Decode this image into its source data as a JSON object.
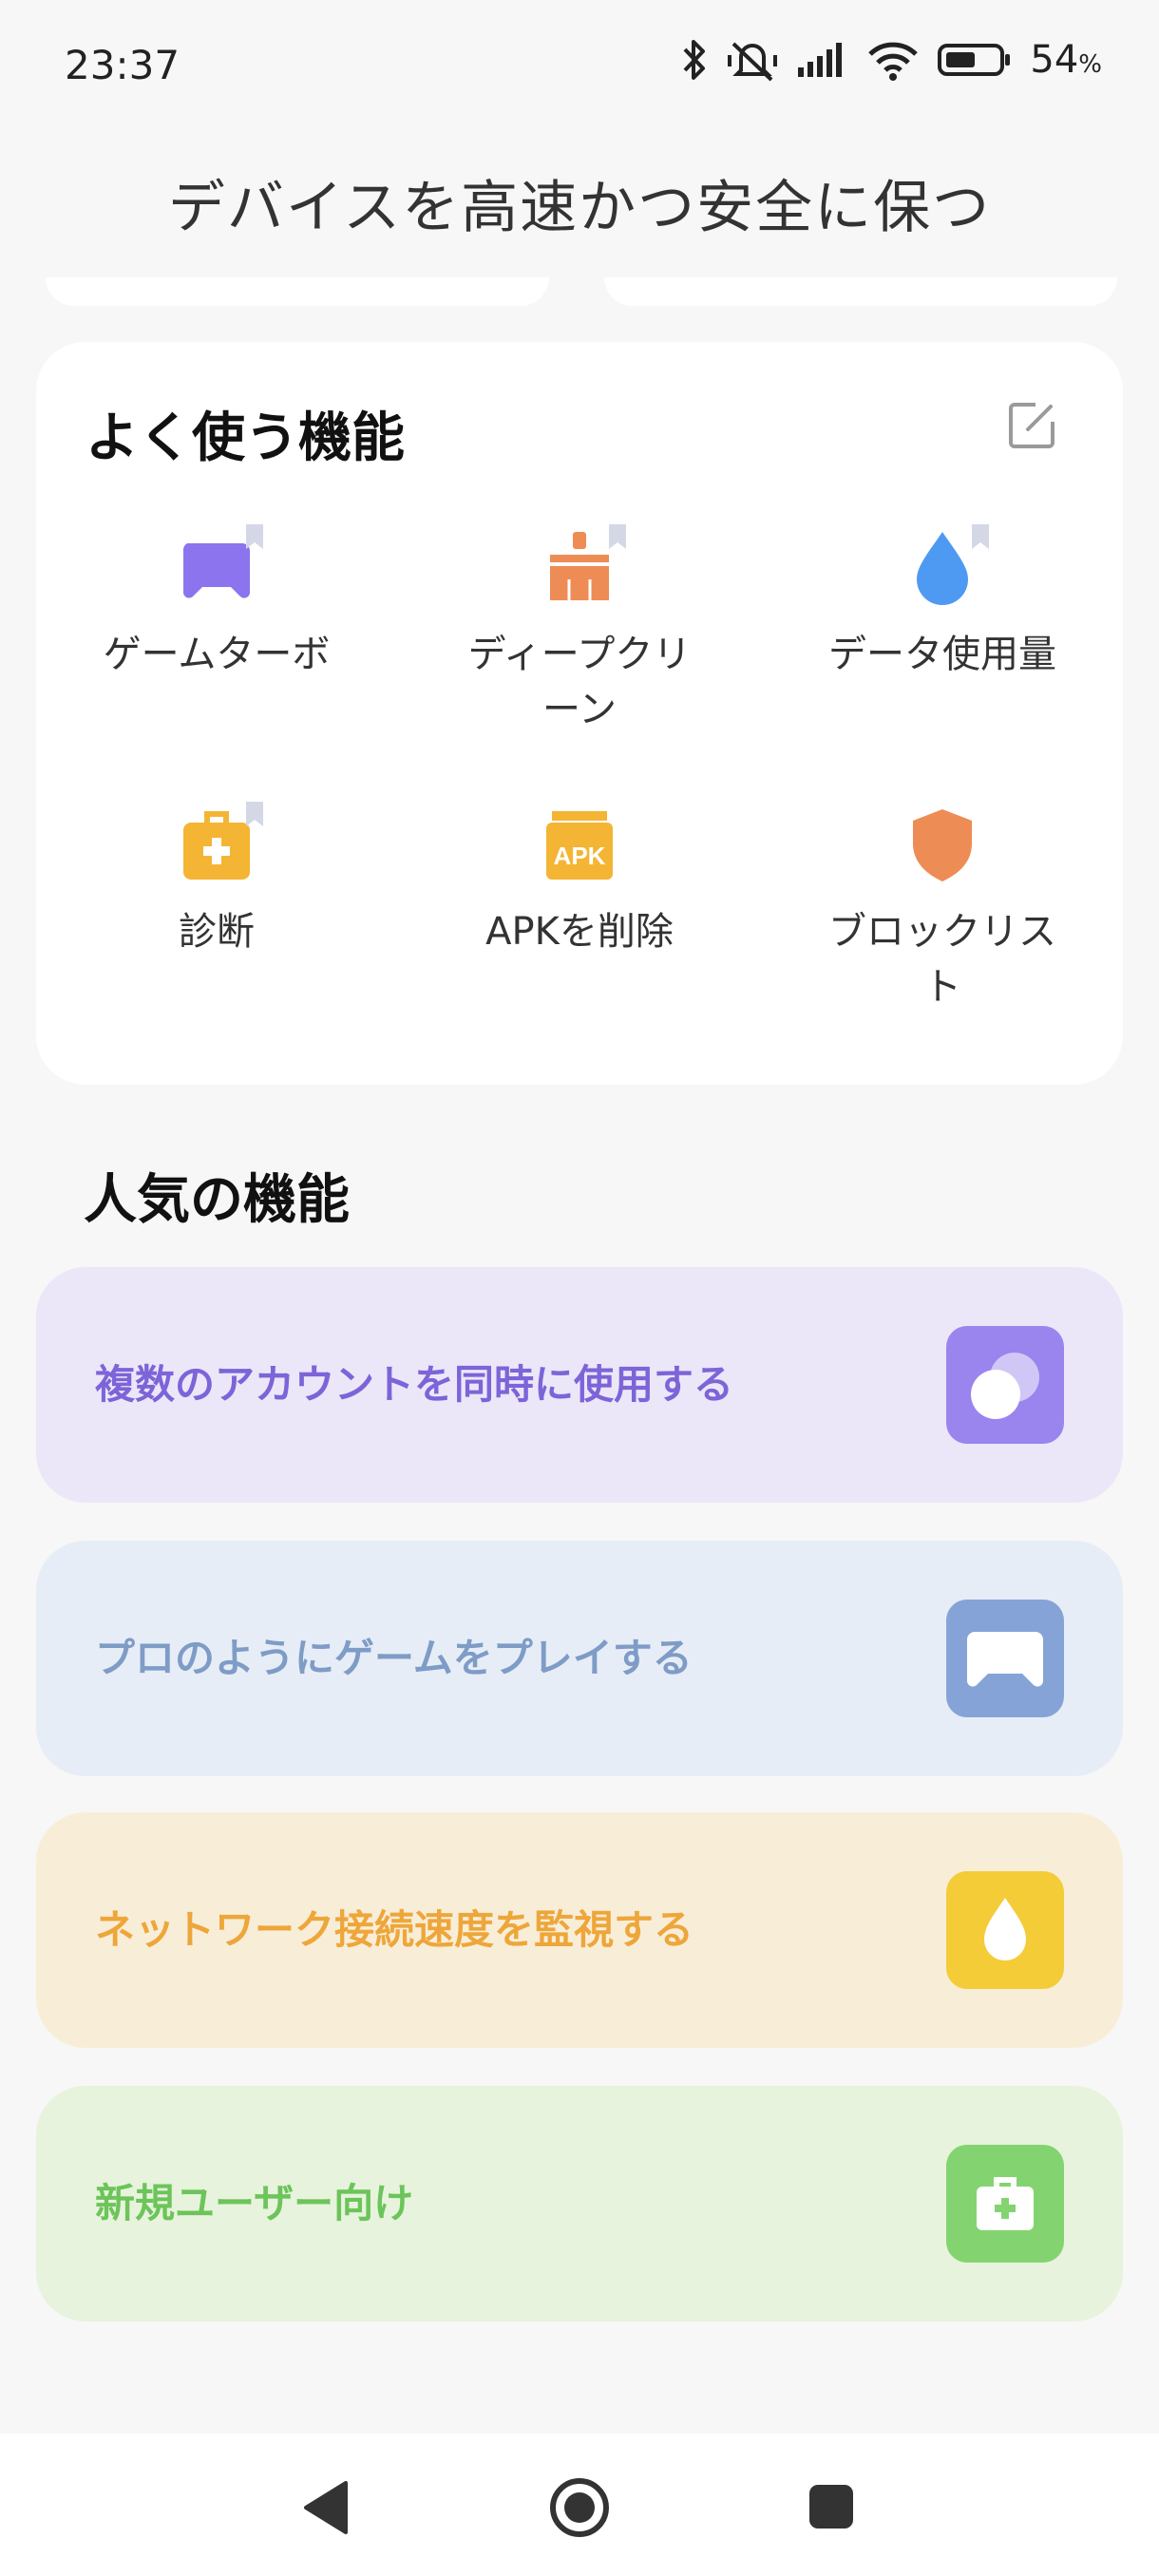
{
  "status": {
    "time": "23:37",
    "battery_percent": "54",
    "battery_unit": "%"
  },
  "page_title": "デバイスを高速かつ安全に保つ",
  "frequent": {
    "title": "よく使う機能",
    "items": [
      {
        "label": "ゲームターボ",
        "icon": "gamepad-icon",
        "color": "#8b74ee"
      },
      {
        "label": "ディープクリーン",
        "icon": "broom-icon",
        "color": "#ee8c56"
      },
      {
        "label": "データ使用量",
        "icon": "water-drop-icon",
        "color": "#4e9af3"
      },
      {
        "label": "診断",
        "icon": "first-aid-kit-icon",
        "color": "#f4b534"
      },
      {
        "label": "APKを削除",
        "icon": "apk-box-icon",
        "color": "#f4b534",
        "apk_text": "APK"
      },
      {
        "label": "ブロックリスト",
        "icon": "shield-icon",
        "color": "#ee8c56"
      }
    ]
  },
  "popular": {
    "title": "人気の機能",
    "items": [
      {
        "label": "複数のアカウントを同時に使用する",
        "icon": "dual-apps-icon",
        "bg": "#ebe7f8",
        "text_color": "#7d64d8",
        "tile": "#9a84ee"
      },
      {
        "label": "プロのようにゲームをプレイする",
        "icon": "gamepad-icon",
        "bg": "#e7edf6",
        "text_color": "#7e9cc6",
        "tile": "#86a3d8"
      },
      {
        "label": "ネットワーク接続速度を監視する",
        "icon": "water-drop-icon",
        "bg": "#f8eed8",
        "text_color": "#eea63a",
        "tile": "#f4cc38"
      },
      {
        "label": "新規ユーザー向け",
        "icon": "first-aid-kit-icon",
        "bg": "#e7f3dc",
        "text_color": "#6cc45a",
        "tile": "#83d470"
      }
    ]
  }
}
